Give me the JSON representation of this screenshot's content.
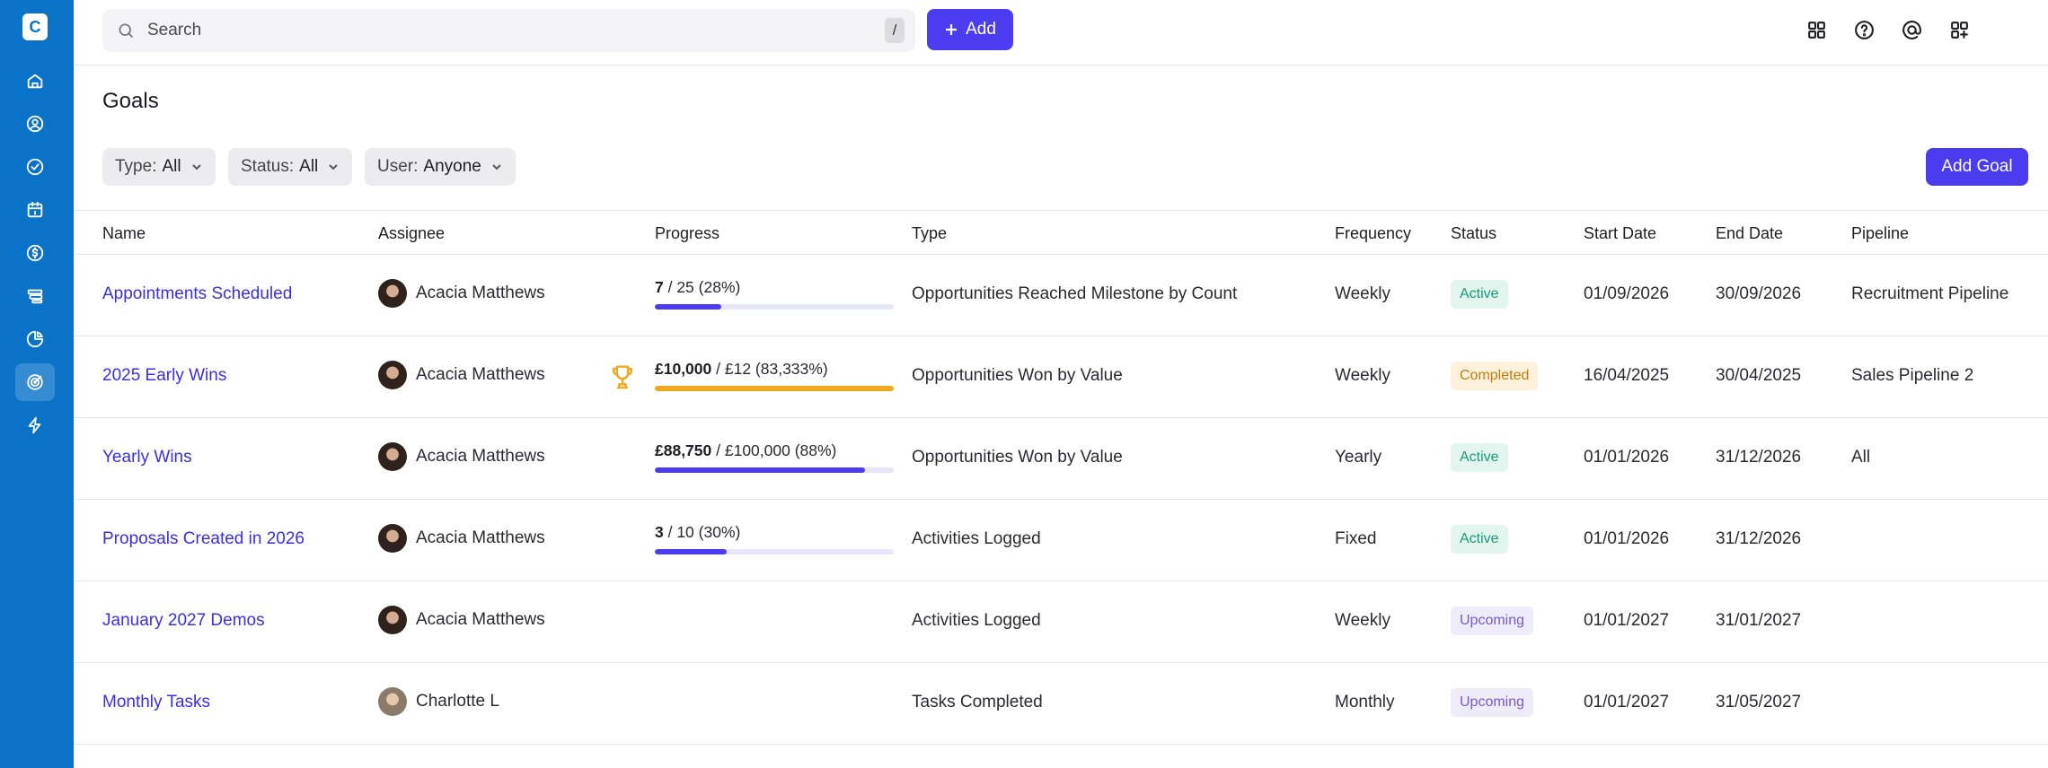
{
  "app": {
    "logo_letter": "C"
  },
  "sidebar": {
    "items": [
      {
        "icon": "home-icon"
      },
      {
        "icon": "contacts-icon"
      },
      {
        "icon": "tasks-icon"
      },
      {
        "icon": "calendar-icon"
      },
      {
        "icon": "dollar-icon"
      },
      {
        "icon": "pipeline-icon"
      },
      {
        "icon": "reports-icon"
      },
      {
        "icon": "goals-icon",
        "active": true
      },
      {
        "icon": "automation-icon"
      }
    ]
  },
  "topbar": {
    "search_placeholder": "Search",
    "search_shortcut": "/",
    "add_label": "Add",
    "icons": [
      "apps-grid-icon",
      "help-icon",
      "mentions-icon",
      "add-widget-icon",
      "user-avatar"
    ]
  },
  "page": {
    "title": "Goals",
    "filters": [
      {
        "label": "Type:",
        "value": "All"
      },
      {
        "label": "Status:",
        "value": "All"
      },
      {
        "label": "User:",
        "value": "Anyone"
      }
    ],
    "add_goal_label": "Add Goal"
  },
  "table": {
    "headers": [
      "Name",
      "Assignee",
      "Progress",
      "Type",
      "Frequency",
      "Status",
      "Start Date",
      "End Date",
      "Pipeline"
    ],
    "rows": [
      {
        "name": "Appointments Scheduled",
        "assignee": "Acacia Matthews",
        "progress_current": "7",
        "progress_rest": " / 25 (28%)",
        "progress_fraction": 0.28,
        "progress_color": "purple",
        "trophy": false,
        "type": "Opportunities Reached Milestone by Count",
        "frequency": "Weekly",
        "status": "Active",
        "start": "01/09/2026",
        "end": "30/09/2026",
        "pipeline": "Recruitment Pipeline"
      },
      {
        "name": "2025 Early Wins",
        "assignee": "Acacia Matthews",
        "progress_current": "£10,000",
        "progress_rest": " / £12 (83,333%)",
        "progress_fraction": 1.0,
        "progress_color": "gold",
        "trophy": true,
        "type": "Opportunities Won by Value",
        "frequency": "Weekly",
        "status": "Completed",
        "start": "16/04/2025",
        "end": "30/04/2025",
        "pipeline": "Sales Pipeline 2"
      },
      {
        "name": "Yearly Wins",
        "assignee": "Acacia Matthews",
        "progress_current": "£88,750",
        "progress_rest": " / £100,000 (88%)",
        "progress_fraction": 0.88,
        "progress_color": "purple",
        "trophy": false,
        "type": "Opportunities Won by Value",
        "frequency": "Yearly",
        "status": "Active",
        "start": "01/01/2026",
        "end": "31/12/2026",
        "pipeline": "All"
      },
      {
        "name": "Proposals Created in 2026",
        "assignee": "Acacia Matthews",
        "progress_current": "3",
        "progress_rest": " / 10 (30%)",
        "progress_fraction": 0.3,
        "progress_color": "purple",
        "trophy": false,
        "type": "Activities Logged",
        "frequency": "Fixed",
        "status": "Active",
        "start": "01/01/2026",
        "end": "31/12/2026",
        "pipeline": ""
      },
      {
        "name": "January 2027 Demos",
        "assignee": "Acacia Matthews",
        "progress_current": "",
        "progress_rest": "",
        "progress_fraction": null,
        "progress_color": "",
        "trophy": false,
        "type": "Activities Logged",
        "frequency": "Weekly",
        "status": "Upcoming",
        "start": "01/01/2027",
        "end": "31/01/2027",
        "pipeline": ""
      },
      {
        "name": "Monthly Tasks",
        "assignee": "Charlotte L",
        "progress_current": "",
        "progress_rest": "",
        "progress_fraction": null,
        "progress_color": "",
        "trophy": false,
        "type": "Tasks Completed",
        "frequency": "Monthly",
        "status": "Upcoming",
        "start": "01/01/2027",
        "end": "31/05/2027",
        "pipeline": ""
      }
    ]
  },
  "colors": {
    "sidebar": "#0a73c7",
    "accent": "#4b3cf0",
    "link": "#3b2fe0",
    "gold": "#f0a91e"
  }
}
